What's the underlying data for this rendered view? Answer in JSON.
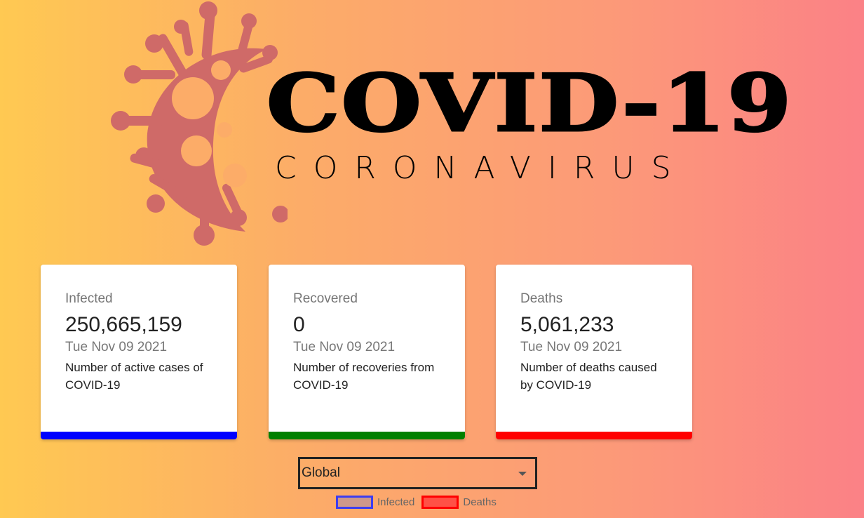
{
  "header": {
    "logo_title": "COVID-19",
    "logo_subtitle": "CORONAVIRUS"
  },
  "colors": {
    "virus": "#cf6a68",
    "infected": "#0000ff",
    "recovered": "#008000",
    "deaths": "#ff0000"
  },
  "cards": [
    {
      "label": "Infected",
      "value": "250,665,159",
      "date": "Tue Nov 09 2021",
      "description": "Number of active cases of COVID-19"
    },
    {
      "label": "Recovered",
      "value": "0",
      "date": "Tue Nov 09 2021",
      "description": "Number of recoveries from COVID-19"
    },
    {
      "label": "Deaths",
      "value": "5,061,233",
      "date": "Tue Nov 09 2021",
      "description": "Number of deaths caused by COVID-19"
    }
  ],
  "country_picker": {
    "selected": "Global"
  },
  "chart_legend": {
    "infected": "Infected",
    "deaths": "Deaths"
  }
}
